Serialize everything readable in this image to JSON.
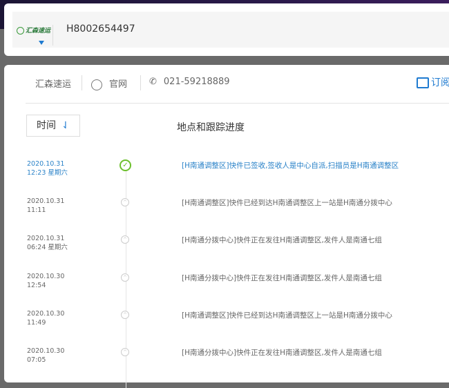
{
  "search": {
    "carrier_logo": "汇森速运",
    "tracking_number": "H8002654497"
  },
  "carrier": {
    "name": "汇森速运",
    "website_label": "官网",
    "phone": "021-59218889",
    "subscribe_label": "订阅"
  },
  "table": {
    "sort_label": "时间",
    "sort_icon": "sort-arrow-icon",
    "column_header": "地点和跟踪进度"
  },
  "colors": {
    "accent": "#1e7ad0",
    "delivered": "#6cbf2c"
  },
  "events": [
    {
      "date": "2020.10.31",
      "time": "12:23 星期六",
      "desc": "[H南通调整区]快件已签收,签收人是中心自派,扫描员是H南通调整区",
      "status": "delivered"
    },
    {
      "date": "2020.10.31",
      "time": "11:11",
      "desc": "[H南通调整区]快件已经到达H南通调整区上一站是H南通分拨中心",
      "status": "transit"
    },
    {
      "date": "2020.10.31",
      "time": "06:24 星期六",
      "desc": "[H南通分拨中心]快件正在发往H南通调整区,发件人是南通七组",
      "status": "transit"
    },
    {
      "date": "2020.10.30",
      "time": "12:54",
      "desc": "[H南通分拨中心]快件正在发往H南通调整区,发件人是南通七组",
      "status": "transit"
    },
    {
      "date": "2020.10.30",
      "time": "11:49",
      "desc": "[H南通调整区]快件已经到达H南通调整区上一站是H南通分拨中心",
      "status": "transit"
    },
    {
      "date": "2020.10.30",
      "time": "07:05",
      "desc": "[H南通分拨中心]快件正在发往H南通调整区,发件人是南通七组",
      "status": "transit"
    }
  ]
}
